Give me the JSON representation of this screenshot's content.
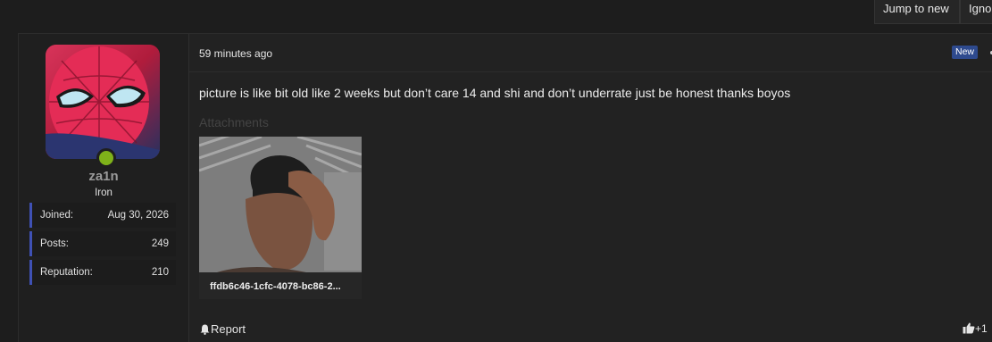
{
  "topbar": {
    "jump_to_new": "Jump to new",
    "ignore": "Ignore"
  },
  "author": {
    "username": "za1n",
    "title": "Iron",
    "online_status_color": "#7fb21a",
    "stats": [
      {
        "label": "Joined:",
        "value": "Aug 30, 2026"
      },
      {
        "label": "Posts:",
        "value": "249"
      },
      {
        "label": "Reputation:",
        "value": "210"
      }
    ]
  },
  "post": {
    "time": "59 minutes ago",
    "badge": "New",
    "message": "picture is like bit old like 2 weeks but don’t care 14 and shi and don’t underrate just be honest thanks boyos",
    "attachments_label": "Attachments",
    "attachment": {
      "filename": "ffdb6c46-1cfc-4078-bc86-2..."
    },
    "report_label": "Report",
    "like_count": "+1"
  },
  "colors": {
    "accent": "#3f51b5",
    "badge": "#2e4a8e"
  },
  "icons": [
    "bell-icon",
    "thumbs-up-icon",
    "more-options-icon"
  ]
}
